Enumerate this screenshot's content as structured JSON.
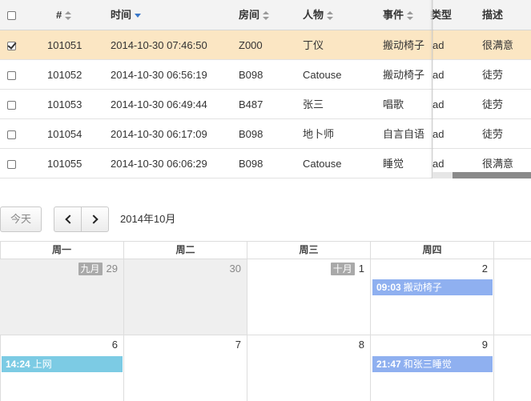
{
  "table": {
    "headers": {
      "id": "#",
      "time": "时间",
      "room": "房间",
      "person": "人物",
      "event": "事件",
      "type": "类型",
      "desc": "描述"
    },
    "rows": [
      {
        "id": "101051",
        "time": "2014-10-30 07:46:50",
        "room": "Z000",
        "person": "丁仪",
        "event": "搬动椅子",
        "type": "ad",
        "desc": "很满意",
        "selected": true
      },
      {
        "id": "101052",
        "time": "2014-10-30 06:56:19",
        "room": "B098",
        "person": "Catouse",
        "event": "搬动椅子",
        "type": "ad",
        "desc": "徒劳",
        "selected": false
      },
      {
        "id": "101053",
        "time": "2014-10-30 06:49:44",
        "room": "B487",
        "person": "张三",
        "event": "唱歌",
        "type": "ad",
        "desc": "徒劳",
        "selected": false
      },
      {
        "id": "101054",
        "time": "2014-10-30 06:17:09",
        "room": "B098",
        "person": "地卜师",
        "event": "自言自语",
        "type": "ad",
        "desc": "徒劳",
        "selected": false
      },
      {
        "id": "101055",
        "time": "2014-10-30 06:06:29",
        "room": "B098",
        "person": "Catouse",
        "event": "睡觉",
        "type": "ad",
        "desc": "很满意",
        "selected": false
      }
    ]
  },
  "calendar": {
    "today_label": "今天",
    "title": "2014年10月",
    "weekdays": [
      "周一",
      "周二",
      "周三",
      "周四"
    ],
    "week1": [
      {
        "num": "29",
        "badge": "九月",
        "other": true
      },
      {
        "num": "30",
        "badge": "",
        "other": true
      },
      {
        "num": "1",
        "badge": "十月",
        "other": false
      },
      {
        "num": "2",
        "badge": "",
        "other": false
      }
    ],
    "week2": [
      {
        "num": "6",
        "badge": "",
        "other": false
      },
      {
        "num": "7",
        "badge": "",
        "other": false
      },
      {
        "num": "8",
        "badge": "",
        "other": false
      },
      {
        "num": "9",
        "badge": "",
        "other": false
      }
    ],
    "events": [
      {
        "time": "09:03",
        "title": "搬动椅子",
        "color": "#8fb0f0"
      },
      {
        "time": "14:24",
        "title": "上网",
        "color": "#7ccbe4"
      },
      {
        "time": "21:47",
        "title": "和张三睡觉",
        "color": "#8fb0f0"
      }
    ]
  },
  "colors": {
    "selected_row": "#fbe6c3",
    "header_bg": "#f3f3f3",
    "other_month_bg": "#efefef"
  }
}
